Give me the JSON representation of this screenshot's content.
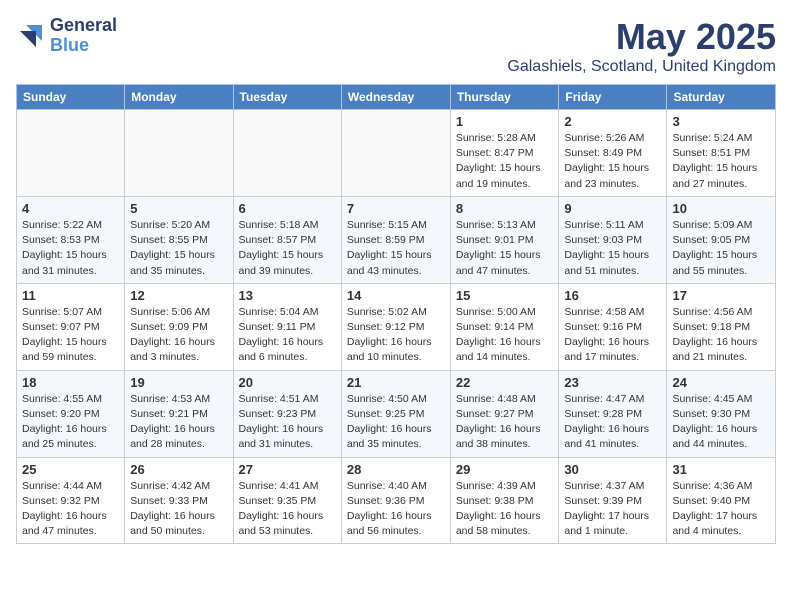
{
  "logo": {
    "general": "General",
    "blue": "Blue"
  },
  "title": "May 2025",
  "location": "Galashiels, Scotland, United Kingdom",
  "days_of_week": [
    "Sunday",
    "Monday",
    "Tuesday",
    "Wednesday",
    "Thursday",
    "Friday",
    "Saturday"
  ],
  "weeks": [
    [
      {
        "day": "",
        "info": ""
      },
      {
        "day": "",
        "info": ""
      },
      {
        "day": "",
        "info": ""
      },
      {
        "day": "",
        "info": ""
      },
      {
        "day": "1",
        "info": "Sunrise: 5:28 AM\nSunset: 8:47 PM\nDaylight: 15 hours\nand 19 minutes."
      },
      {
        "day": "2",
        "info": "Sunrise: 5:26 AM\nSunset: 8:49 PM\nDaylight: 15 hours\nand 23 minutes."
      },
      {
        "day": "3",
        "info": "Sunrise: 5:24 AM\nSunset: 8:51 PM\nDaylight: 15 hours\nand 27 minutes."
      }
    ],
    [
      {
        "day": "4",
        "info": "Sunrise: 5:22 AM\nSunset: 8:53 PM\nDaylight: 15 hours\nand 31 minutes."
      },
      {
        "day": "5",
        "info": "Sunrise: 5:20 AM\nSunset: 8:55 PM\nDaylight: 15 hours\nand 35 minutes."
      },
      {
        "day": "6",
        "info": "Sunrise: 5:18 AM\nSunset: 8:57 PM\nDaylight: 15 hours\nand 39 minutes."
      },
      {
        "day": "7",
        "info": "Sunrise: 5:15 AM\nSunset: 8:59 PM\nDaylight: 15 hours\nand 43 minutes."
      },
      {
        "day": "8",
        "info": "Sunrise: 5:13 AM\nSunset: 9:01 PM\nDaylight: 15 hours\nand 47 minutes."
      },
      {
        "day": "9",
        "info": "Sunrise: 5:11 AM\nSunset: 9:03 PM\nDaylight: 15 hours\nand 51 minutes."
      },
      {
        "day": "10",
        "info": "Sunrise: 5:09 AM\nSunset: 9:05 PM\nDaylight: 15 hours\nand 55 minutes."
      }
    ],
    [
      {
        "day": "11",
        "info": "Sunrise: 5:07 AM\nSunset: 9:07 PM\nDaylight: 15 hours\nand 59 minutes."
      },
      {
        "day": "12",
        "info": "Sunrise: 5:06 AM\nSunset: 9:09 PM\nDaylight: 16 hours\nand 3 minutes."
      },
      {
        "day": "13",
        "info": "Sunrise: 5:04 AM\nSunset: 9:11 PM\nDaylight: 16 hours\nand 6 minutes."
      },
      {
        "day": "14",
        "info": "Sunrise: 5:02 AM\nSunset: 9:12 PM\nDaylight: 16 hours\nand 10 minutes."
      },
      {
        "day": "15",
        "info": "Sunrise: 5:00 AM\nSunset: 9:14 PM\nDaylight: 16 hours\nand 14 minutes."
      },
      {
        "day": "16",
        "info": "Sunrise: 4:58 AM\nSunset: 9:16 PM\nDaylight: 16 hours\nand 17 minutes."
      },
      {
        "day": "17",
        "info": "Sunrise: 4:56 AM\nSunset: 9:18 PM\nDaylight: 16 hours\nand 21 minutes."
      }
    ],
    [
      {
        "day": "18",
        "info": "Sunrise: 4:55 AM\nSunset: 9:20 PM\nDaylight: 16 hours\nand 25 minutes."
      },
      {
        "day": "19",
        "info": "Sunrise: 4:53 AM\nSunset: 9:21 PM\nDaylight: 16 hours\nand 28 minutes."
      },
      {
        "day": "20",
        "info": "Sunrise: 4:51 AM\nSunset: 9:23 PM\nDaylight: 16 hours\nand 31 minutes."
      },
      {
        "day": "21",
        "info": "Sunrise: 4:50 AM\nSunset: 9:25 PM\nDaylight: 16 hours\nand 35 minutes."
      },
      {
        "day": "22",
        "info": "Sunrise: 4:48 AM\nSunset: 9:27 PM\nDaylight: 16 hours\nand 38 minutes."
      },
      {
        "day": "23",
        "info": "Sunrise: 4:47 AM\nSunset: 9:28 PM\nDaylight: 16 hours\nand 41 minutes."
      },
      {
        "day": "24",
        "info": "Sunrise: 4:45 AM\nSunset: 9:30 PM\nDaylight: 16 hours\nand 44 minutes."
      }
    ],
    [
      {
        "day": "25",
        "info": "Sunrise: 4:44 AM\nSunset: 9:32 PM\nDaylight: 16 hours\nand 47 minutes."
      },
      {
        "day": "26",
        "info": "Sunrise: 4:42 AM\nSunset: 9:33 PM\nDaylight: 16 hours\nand 50 minutes."
      },
      {
        "day": "27",
        "info": "Sunrise: 4:41 AM\nSunset: 9:35 PM\nDaylight: 16 hours\nand 53 minutes."
      },
      {
        "day": "28",
        "info": "Sunrise: 4:40 AM\nSunset: 9:36 PM\nDaylight: 16 hours\nand 56 minutes."
      },
      {
        "day": "29",
        "info": "Sunrise: 4:39 AM\nSunset: 9:38 PM\nDaylight: 16 hours\nand 58 minutes."
      },
      {
        "day": "30",
        "info": "Sunrise: 4:37 AM\nSunset: 9:39 PM\nDaylight: 17 hours\nand 1 minute."
      },
      {
        "day": "31",
        "info": "Sunrise: 4:36 AM\nSunset: 9:40 PM\nDaylight: 17 hours\nand 4 minutes."
      }
    ]
  ]
}
